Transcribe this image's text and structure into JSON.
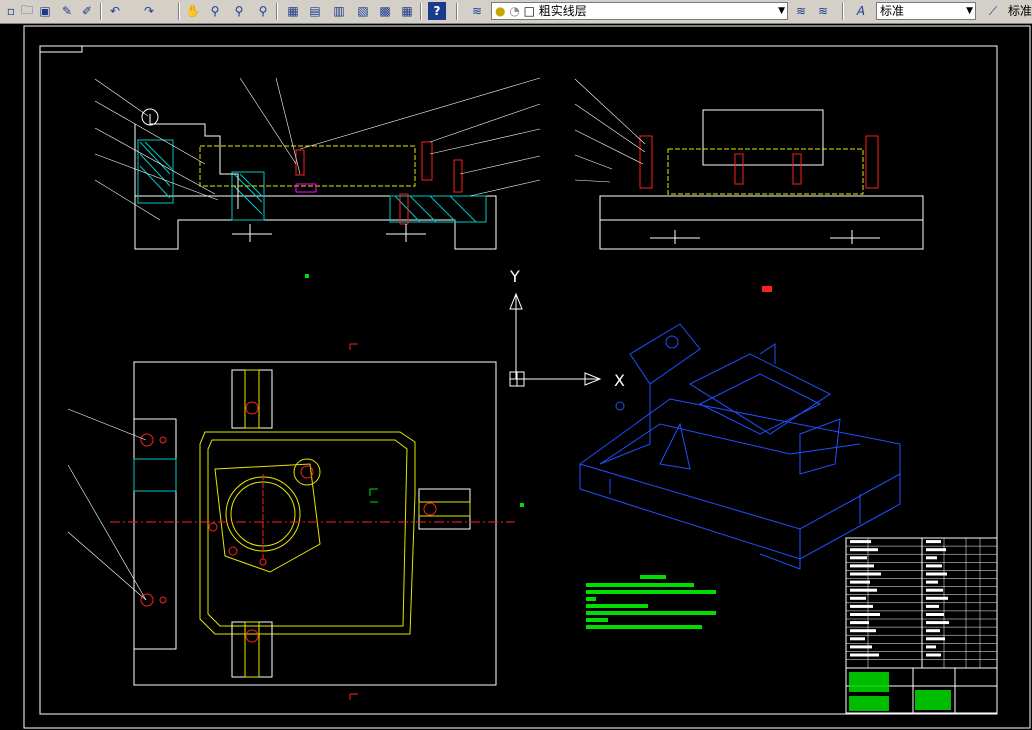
{
  "toolbar": {
    "layer_name": "粗实线层",
    "text_style": "标准",
    "extra_style_label": "标准",
    "buttons": [
      "new-icon",
      "open-icon",
      "save-icon",
      "pen-icon",
      "brush-icon",
      "undo-icon",
      "redo-icon",
      "pan-icon",
      "zoom-realtime-icon",
      "zoom-window-icon",
      "zoom-previous-icon",
      "properties-icon",
      "design-center-icon",
      "tool-palette-icon",
      "sheet-set-icon",
      "markup-icon",
      "calculator-icon",
      "help-icon",
      "layer-manager-icon",
      "layer-state-icon",
      "make-current-icon",
      "layer-previous-icon",
      "text-style-icon",
      "dim-style-icon"
    ]
  },
  "colors": {
    "background": "#000000",
    "outline": "#ffffff",
    "hidden_line": "#e6e600",
    "part_highlight": "#ff2020",
    "hatch": "#00c8c8",
    "iso_view": "#2050ff",
    "notes": "#00dd00"
  },
  "drawing": {
    "axis_labels": {
      "y": "Y",
      "x": "X"
    },
    "title_block_present": true
  }
}
